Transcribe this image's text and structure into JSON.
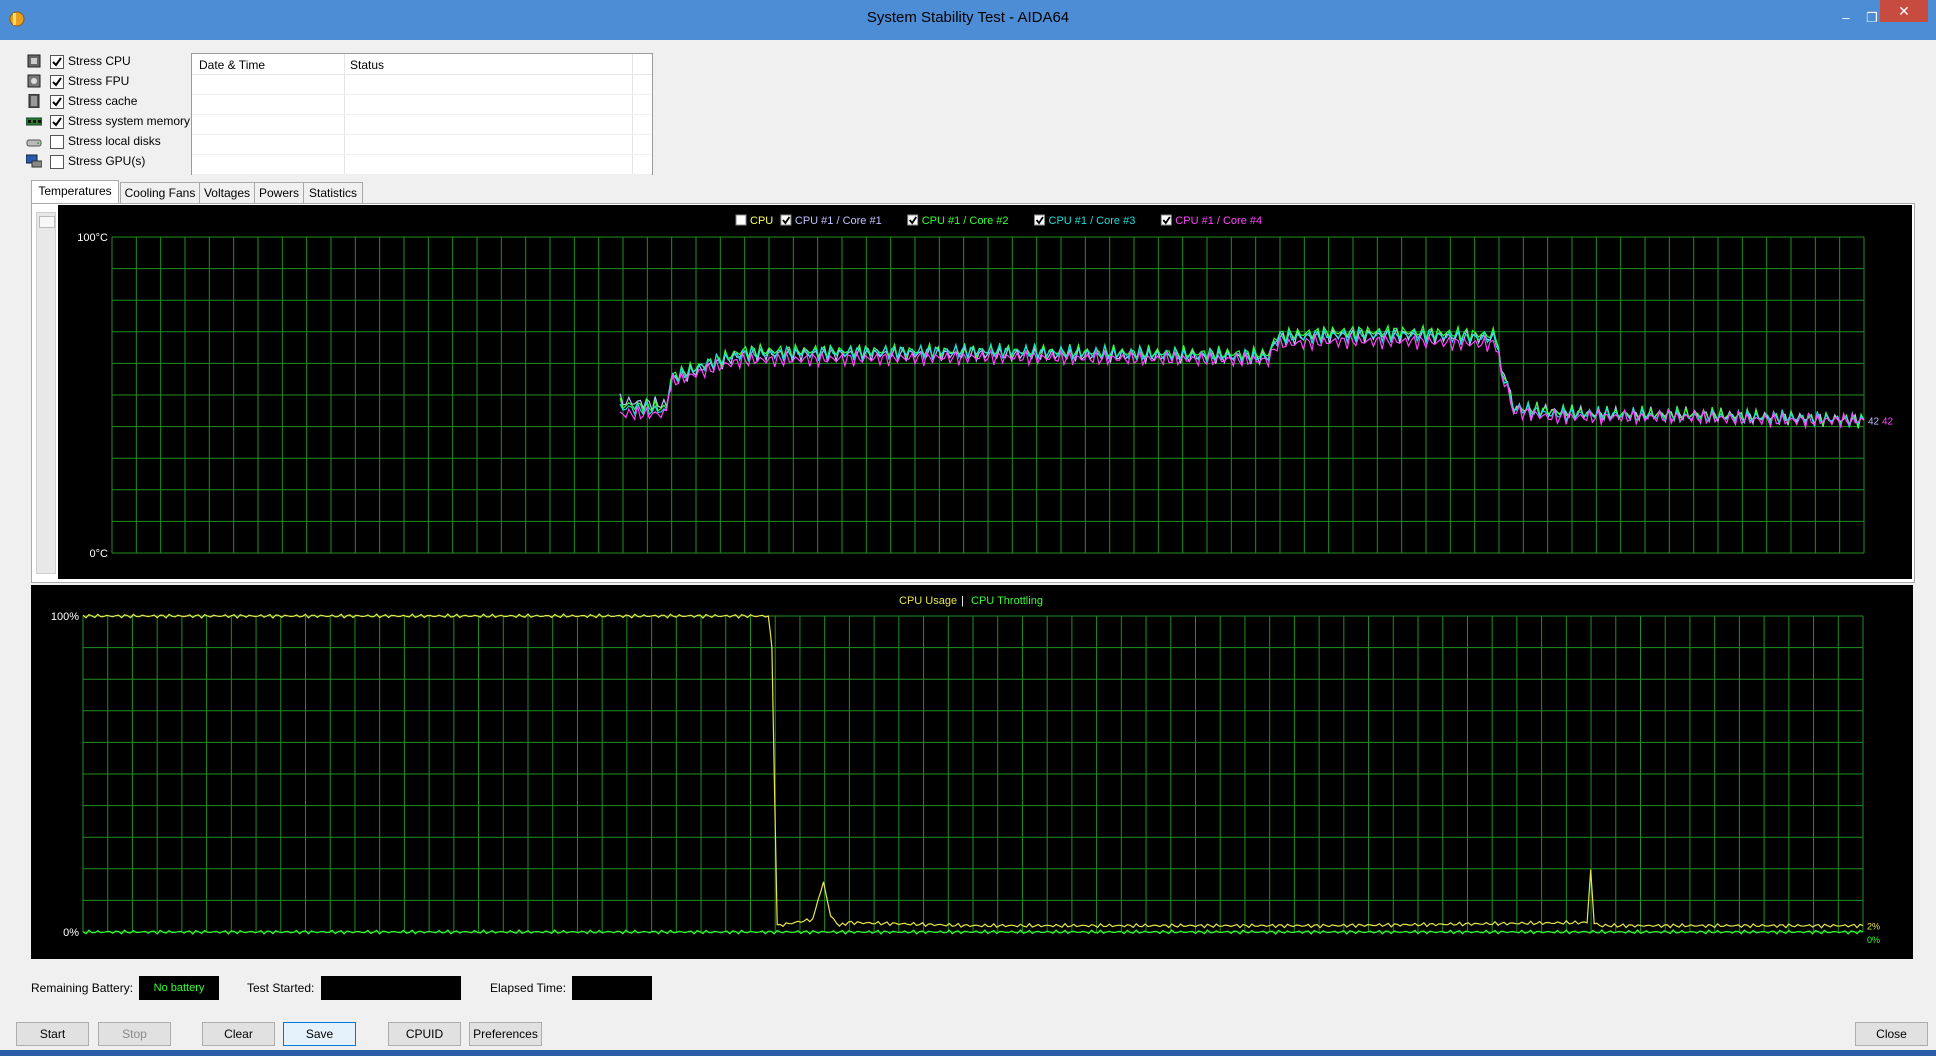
{
  "window": {
    "title": "System Stability Test - AIDA64",
    "close_glyph": "✕",
    "minimize_glyph": "–",
    "restore_glyph": "❐"
  },
  "stress": [
    {
      "label": "Stress CPU",
      "checked": true,
      "icon": "cpu-icon"
    },
    {
      "label": "Stress FPU",
      "checked": true,
      "icon": "fpu-icon"
    },
    {
      "label": "Stress cache",
      "checked": true,
      "icon": "cache-icon"
    },
    {
      "label": "Stress system memory",
      "checked": true,
      "icon": "memory-icon"
    },
    {
      "label": "Stress local disks",
      "checked": false,
      "icon": "disk-icon"
    },
    {
      "label": "Stress GPU(s)",
      "checked": false,
      "icon": "gpu-icon"
    }
  ],
  "log": {
    "headers": [
      "Date & Time",
      "Status"
    ]
  },
  "tabs": [
    "Temperatures",
    "Cooling Fans",
    "Voltages",
    "Powers",
    "Statistics"
  ],
  "colors": {
    "grid": "#1f8f1f",
    "cpu": "#ffffff",
    "core1": "#c0c0ff",
    "core2": "#33ff33",
    "core3": "#22dddd",
    "core4": "#ff44ff",
    "usage": "#e6e64a",
    "throttle": "#33ff33"
  },
  "chart_data": [
    {
      "type": "line",
      "legend": [
        {
          "label": "CPU",
          "checked": false,
          "color": "#ffffff"
        },
        {
          "label": "CPU #1 / Core #1",
          "checked": true,
          "color": "#c0c0ff"
        },
        {
          "label": "CPU #1 / Core #2",
          "checked": true,
          "color": "#33ff33"
        },
        {
          "label": "CPU #1 / Core #3",
          "checked": true,
          "color": "#22dddd"
        },
        {
          "label": "CPU #1 / Core #4",
          "checked": true,
          "color": "#ff44ff"
        }
      ],
      "ymax_label": "100°C",
      "ymin_label": "0°C",
      "ylim": [
        0,
        100
      ],
      "xlim": [
        0,
        100
      ],
      "end_labels": [
        "42",
        "42"
      ],
      "series": [
        {
          "name": "CPU #1 / Core #1",
          "x": [
            29,
            31.5,
            31.8,
            32,
            34,
            36,
            50,
            66,
            66.5,
            70,
            74,
            79,
            79.3,
            80,
            82,
            85,
            90,
            95,
            100
          ],
          "y": [
            48,
            47,
            50,
            55,
            59,
            63,
            63,
            62,
            68,
            69,
            69,
            68,
            60,
            46,
            45,
            44,
            44,
            43,
            42
          ]
        },
        {
          "name": "CPU #1 / Core #2",
          "x": [
            29,
            31.5,
            31.8,
            32,
            34,
            36,
            50,
            66,
            66.5,
            70,
            74,
            79,
            79.3,
            80,
            82,
            85,
            90,
            95,
            100
          ],
          "y": [
            47,
            46,
            50,
            56,
            60,
            64,
            64,
            63,
            69,
            70,
            70,
            69,
            59,
            46,
            45,
            44,
            44,
            43,
            42
          ]
        },
        {
          "name": "CPU #1 / Core #3",
          "x": [
            29,
            31.5,
            31.8,
            32,
            34,
            36,
            50,
            66,
            66.5,
            70,
            74,
            79,
            79.3,
            80,
            82,
            85,
            90,
            95,
            100
          ],
          "y": [
            46,
            45,
            49,
            55,
            60,
            63,
            64,
            62,
            68,
            69,
            69,
            68,
            58,
            46,
            44,
            44,
            43,
            43,
            42
          ]
        },
        {
          "name": "CPU #1 / Core #4",
          "x": [
            29,
            31.5,
            31.8,
            32,
            34,
            36,
            50,
            66,
            66.5,
            70,
            74,
            79,
            79.3,
            80,
            82,
            85,
            90,
            95,
            100
          ],
          "y": [
            44,
            44,
            48,
            54,
            58,
            61,
            62,
            61,
            66,
            67,
            67,
            66,
            57,
            45,
            43,
            43,
            43,
            42,
            42
          ]
        }
      ]
    },
    {
      "type": "line",
      "legend": [
        {
          "label": "CPU Usage",
          "color": "#e6e64a"
        },
        {
          "label": "CPU Throttling",
          "color": "#33ff33"
        }
      ],
      "separator": "|",
      "ymax_label": "100%",
      "ymin_label": "0%",
      "ylim": [
        0,
        100
      ],
      "xlim": [
        0,
        100
      ],
      "end_labels": [
        "2%",
        "0%"
      ],
      "series": [
        {
          "name": "CPU Usage",
          "x": [
            0,
            38.5,
            38.7,
            39,
            40,
            41,
            41.3,
            41.6,
            42,
            42.5,
            43,
            50,
            60,
            70,
            84.5,
            84.7,
            84.9,
            85.2,
            90,
            95,
            100
          ],
          "y": [
            100,
            100,
            90,
            2,
            3,
            4,
            10,
            16,
            5,
            2,
            3,
            2,
            2,
            2,
            3,
            20,
            3,
            2,
            2,
            2,
            2
          ]
        },
        {
          "name": "CPU Throttling",
          "x": [
            0,
            100
          ],
          "y": [
            0,
            0
          ]
        }
      ]
    }
  ],
  "status": {
    "battery_label": "Remaining Battery:",
    "battery_value": "No battery",
    "started_label": "Test Started:",
    "elapsed_label": "Elapsed Time:"
  },
  "buttons": {
    "start": "Start",
    "stop": "Stop",
    "clear": "Clear",
    "save": "Save",
    "cpuid": "CPUID",
    "preferences": "Preferences",
    "close": "Close"
  }
}
